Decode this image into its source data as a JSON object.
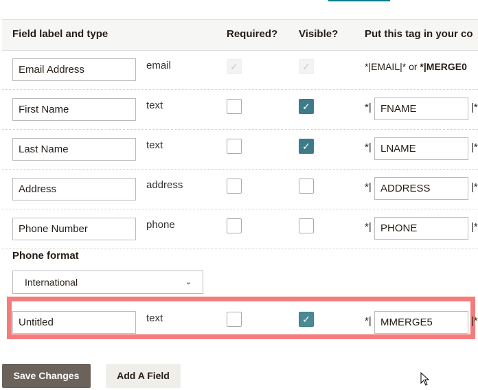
{
  "header": {
    "label_type": "Field label and type",
    "required": "Required?",
    "visible": "Visible?",
    "tag": "Put this tag in your co"
  },
  "email_row": {
    "label": "Email Address",
    "type": "email",
    "tag_text": "*|EMAIL|* or ",
    "tag_bold": "*|MERGE0"
  },
  "rows": [
    {
      "label": "First Name",
      "type": "text",
      "required": false,
      "visible": true,
      "prefix": "*|",
      "tag": "FNAME",
      "suffix": "|*"
    },
    {
      "label": "Last Name",
      "type": "text",
      "required": false,
      "visible": true,
      "prefix": "*|",
      "tag": "LNAME",
      "suffix": "|*"
    },
    {
      "label": "Address",
      "type": "address",
      "required": false,
      "visible": false,
      "prefix": "*|",
      "tag": "ADDRESS",
      "suffix": "|*"
    },
    {
      "label": "Phone Number",
      "type": "phone",
      "required": false,
      "visible": false,
      "prefix": "*|",
      "tag": "PHONE",
      "suffix": "|*"
    }
  ],
  "phone_format": {
    "label": "Phone format",
    "selected": "International"
  },
  "new_row": {
    "label": "Untitled",
    "type": "text",
    "required": false,
    "visible": true,
    "prefix": "*|",
    "tag": "MMERGE5",
    "suffix": "|*"
  },
  "buttons": {
    "save": "Save Changes",
    "add": "Add A Field"
  },
  "colors": {
    "accent": "#3d7b88",
    "highlight": "#f47c7c",
    "save_bg": "#6b625c"
  }
}
